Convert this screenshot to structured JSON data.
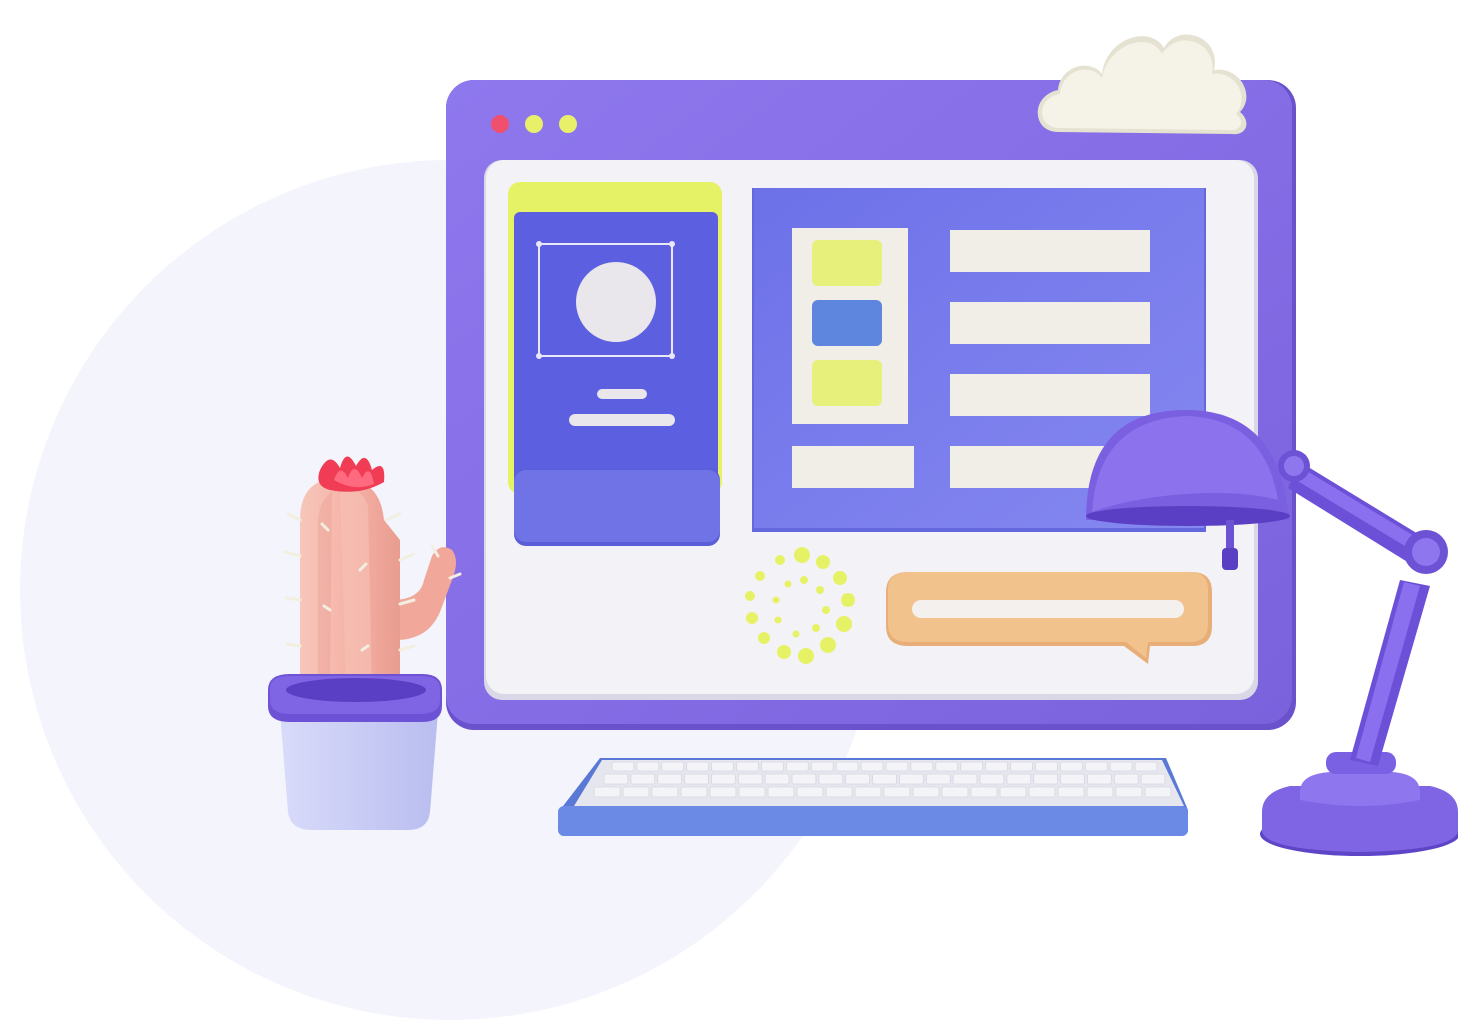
{
  "illustration": {
    "subject": "desktop-workspace",
    "window_dots": [
      "red",
      "yellow",
      "yellow"
    ],
    "sidebar_buttons": [
      "yellow",
      "blue",
      "yellow"
    ],
    "content_lines": 5,
    "icons": [
      "cloud-icon",
      "image-frame-icon",
      "loading-spinner-icon",
      "chat-bubble-icon",
      "cactus-icon",
      "desk-lamp-icon",
      "keyboard-icon"
    ]
  },
  "colors": {
    "background_circle": "#f4f4fc",
    "window_frame": "#8a72ea",
    "window_frame_dark": "#7a62dd",
    "screen": "#f3f2f6",
    "panel": "#7b80ee",
    "card_accent": "#e6f266",
    "card_body": "#5b5fe0",
    "card_pocket": "#6f73e6",
    "cream": "#f0eee6",
    "dot_red": "#f0506e",
    "dot_yellow": "#e8f06a",
    "button_blue": "#5f86de",
    "chat_bubble": "#f2c28d",
    "cactus": "#f4b4a8",
    "flower": "#f03c54",
    "pot_rim": "#7a5fe0",
    "pot_body": "#cfd2f6",
    "lamp": "#7f64e4",
    "keyboard_base": "#6a8ae6",
    "key": "#f4f4f8",
    "cloud": "#f5f3e8"
  }
}
